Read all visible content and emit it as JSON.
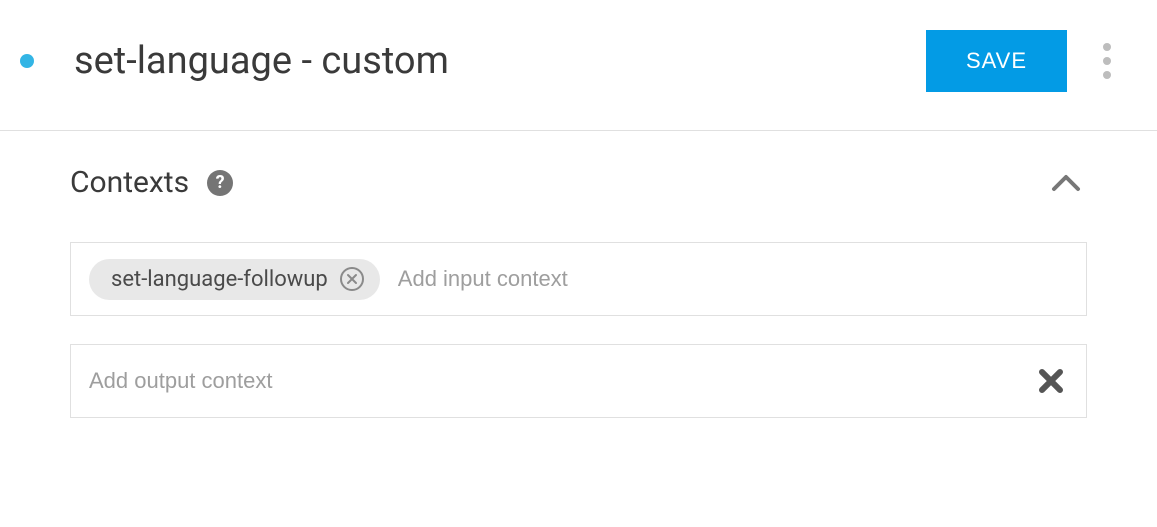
{
  "header": {
    "title": "set-language - custom",
    "save_label": "SAVE"
  },
  "contexts": {
    "section_title": "Contexts",
    "input": {
      "chips": [
        "set-language-followup"
      ],
      "placeholder": "Add input context"
    },
    "output": {
      "placeholder": "Add output context"
    }
  }
}
